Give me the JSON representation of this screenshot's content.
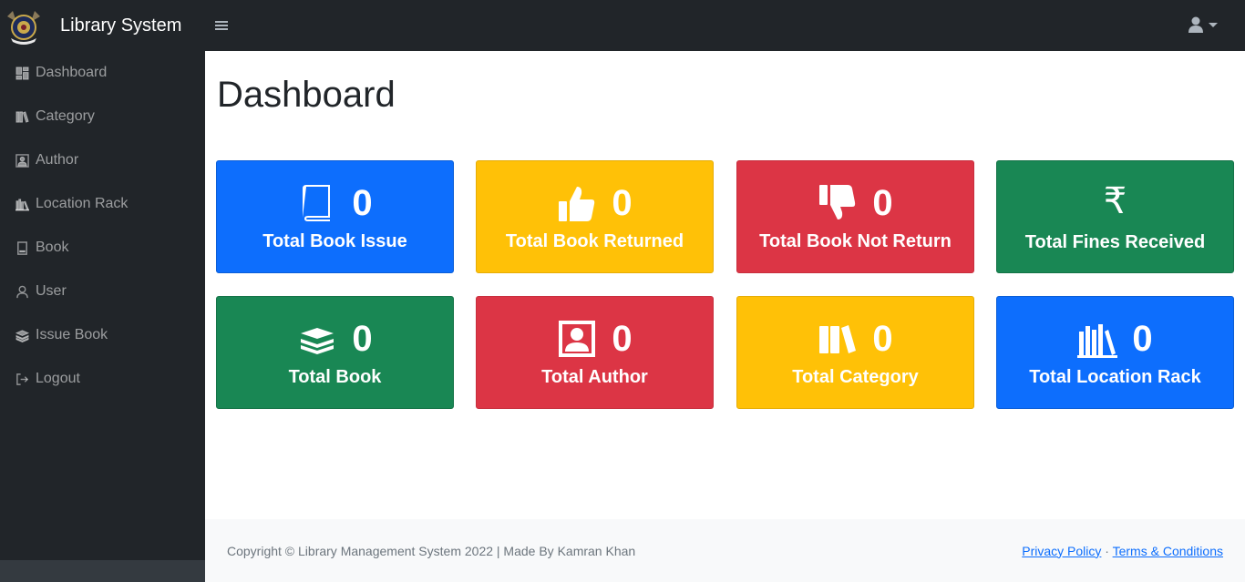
{
  "app": {
    "title": "Library System"
  },
  "sidebar": {
    "items": [
      {
        "label": "Dashboard",
        "icon": "dashboard-icon"
      },
      {
        "label": "Category",
        "icon": "books-icon"
      },
      {
        "label": "Author",
        "icon": "author-portrait-icon"
      },
      {
        "label": "Location Rack",
        "icon": "rack-icon"
      },
      {
        "label": "Book",
        "icon": "book-icon"
      },
      {
        "label": "User",
        "icon": "user-icon"
      },
      {
        "label": "Issue Book",
        "icon": "book-stack-icon"
      },
      {
        "label": "Logout",
        "icon": "logout-icon"
      }
    ]
  },
  "main": {
    "title": "Dashboard",
    "cards": [
      {
        "value": "0",
        "label": "Total Book Issue",
        "color": "#0d6efd",
        "icon": "book-icon"
      },
      {
        "value": "0",
        "label": "Total Book Returned",
        "color": "#ffc107",
        "icon": "thumbs-up-icon"
      },
      {
        "value": "0",
        "label": "Total Book Not Return",
        "color": "#dc3545",
        "icon": "thumbs-down-icon"
      },
      {
        "value": "₹",
        "label": "Total Fines Received",
        "color": "#198754",
        "icon": "rupee-icon"
      },
      {
        "value": "0",
        "label": "Total Book",
        "color": "#198754",
        "icon": "book-stack-icon"
      },
      {
        "value": "0",
        "label": "Total Author",
        "color": "#dc3545",
        "icon": "author-portrait-icon"
      },
      {
        "value": "0",
        "label": "Total Category",
        "color": "#ffc107",
        "icon": "books-icon"
      },
      {
        "value": "0",
        "label": "Total Location Rack",
        "color": "#0d6efd",
        "icon": "rack-icon"
      }
    ]
  },
  "footer": {
    "copyright": "Copyright © Library Management System 2022 | Made By Kamran Khan",
    "privacy": "Privacy Policy",
    "separator": "·",
    "terms": "Terms & Conditions"
  }
}
